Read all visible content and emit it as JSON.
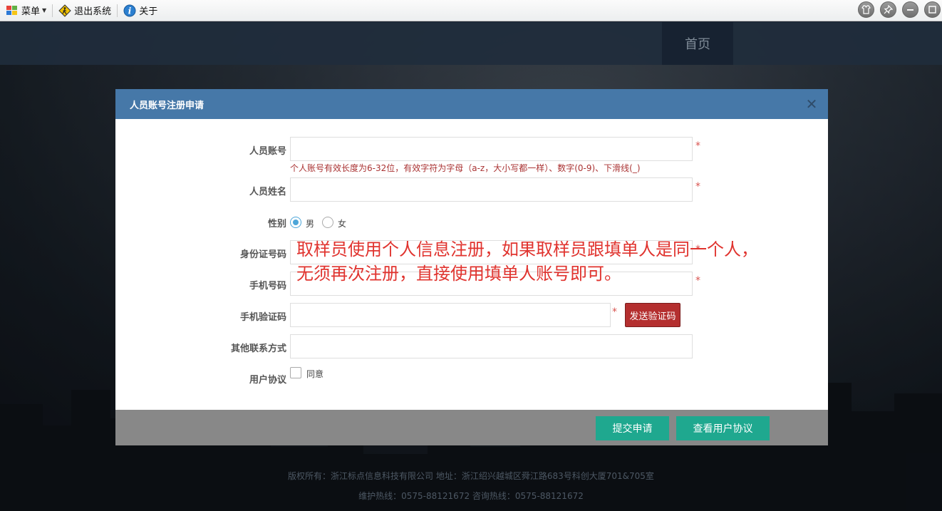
{
  "toolbar": {
    "menu_label": "菜单",
    "logout_label": "退出系统",
    "about_label": "关于"
  },
  "background_page": {
    "nav_home": "首页",
    "footer_line1": "版权所有：浙江标点信息科技有限公司 地址：浙江绍兴越城区舜江路683号科创大厦701&705室",
    "footer_line2": "维护热线：0575-88121672 咨询热线：0575-88121672"
  },
  "modal": {
    "title": "人员账号注册申请",
    "fields": {
      "account": {
        "label": "人员账号",
        "value": "",
        "required_mark": "*",
        "hint": "个人账号有效长度为6-32位，有效字符为字母（a-z，大小写都一样）、数字(0-9)、下滑线(_)"
      },
      "name": {
        "label": "人员姓名",
        "value": "",
        "required_mark": "*"
      },
      "gender": {
        "label": "性别",
        "options": [
          "男",
          "女"
        ],
        "selected": "男"
      },
      "id_number": {
        "label": "身份证号码",
        "value": "",
        "required_mark": "*"
      },
      "phone": {
        "label": "手机号码",
        "value": "",
        "required_mark": "*"
      },
      "sms_code": {
        "label": "手机验证码",
        "value": "",
        "required_mark": "*",
        "button": "发送验证码"
      },
      "other_contact": {
        "label": "其他联系方式",
        "value": ""
      },
      "agreement": {
        "label": "用户协议",
        "checkbox_text": "同意",
        "checked": false
      }
    },
    "buttons": {
      "submit": "提交申请",
      "view_agreement": "查看用户协议"
    }
  },
  "annotation": {
    "line1": "取样员使用个人信息注册，如果取样员跟填单人是同一个人，",
    "line2": "无须再次注册，直接使用填单人账号即可。"
  },
  "colors": {
    "modal_header": "#4678a8",
    "teal_button": "#1fa88f",
    "sms_button": "#b42f2f",
    "annotation_text": "#e0332e"
  }
}
